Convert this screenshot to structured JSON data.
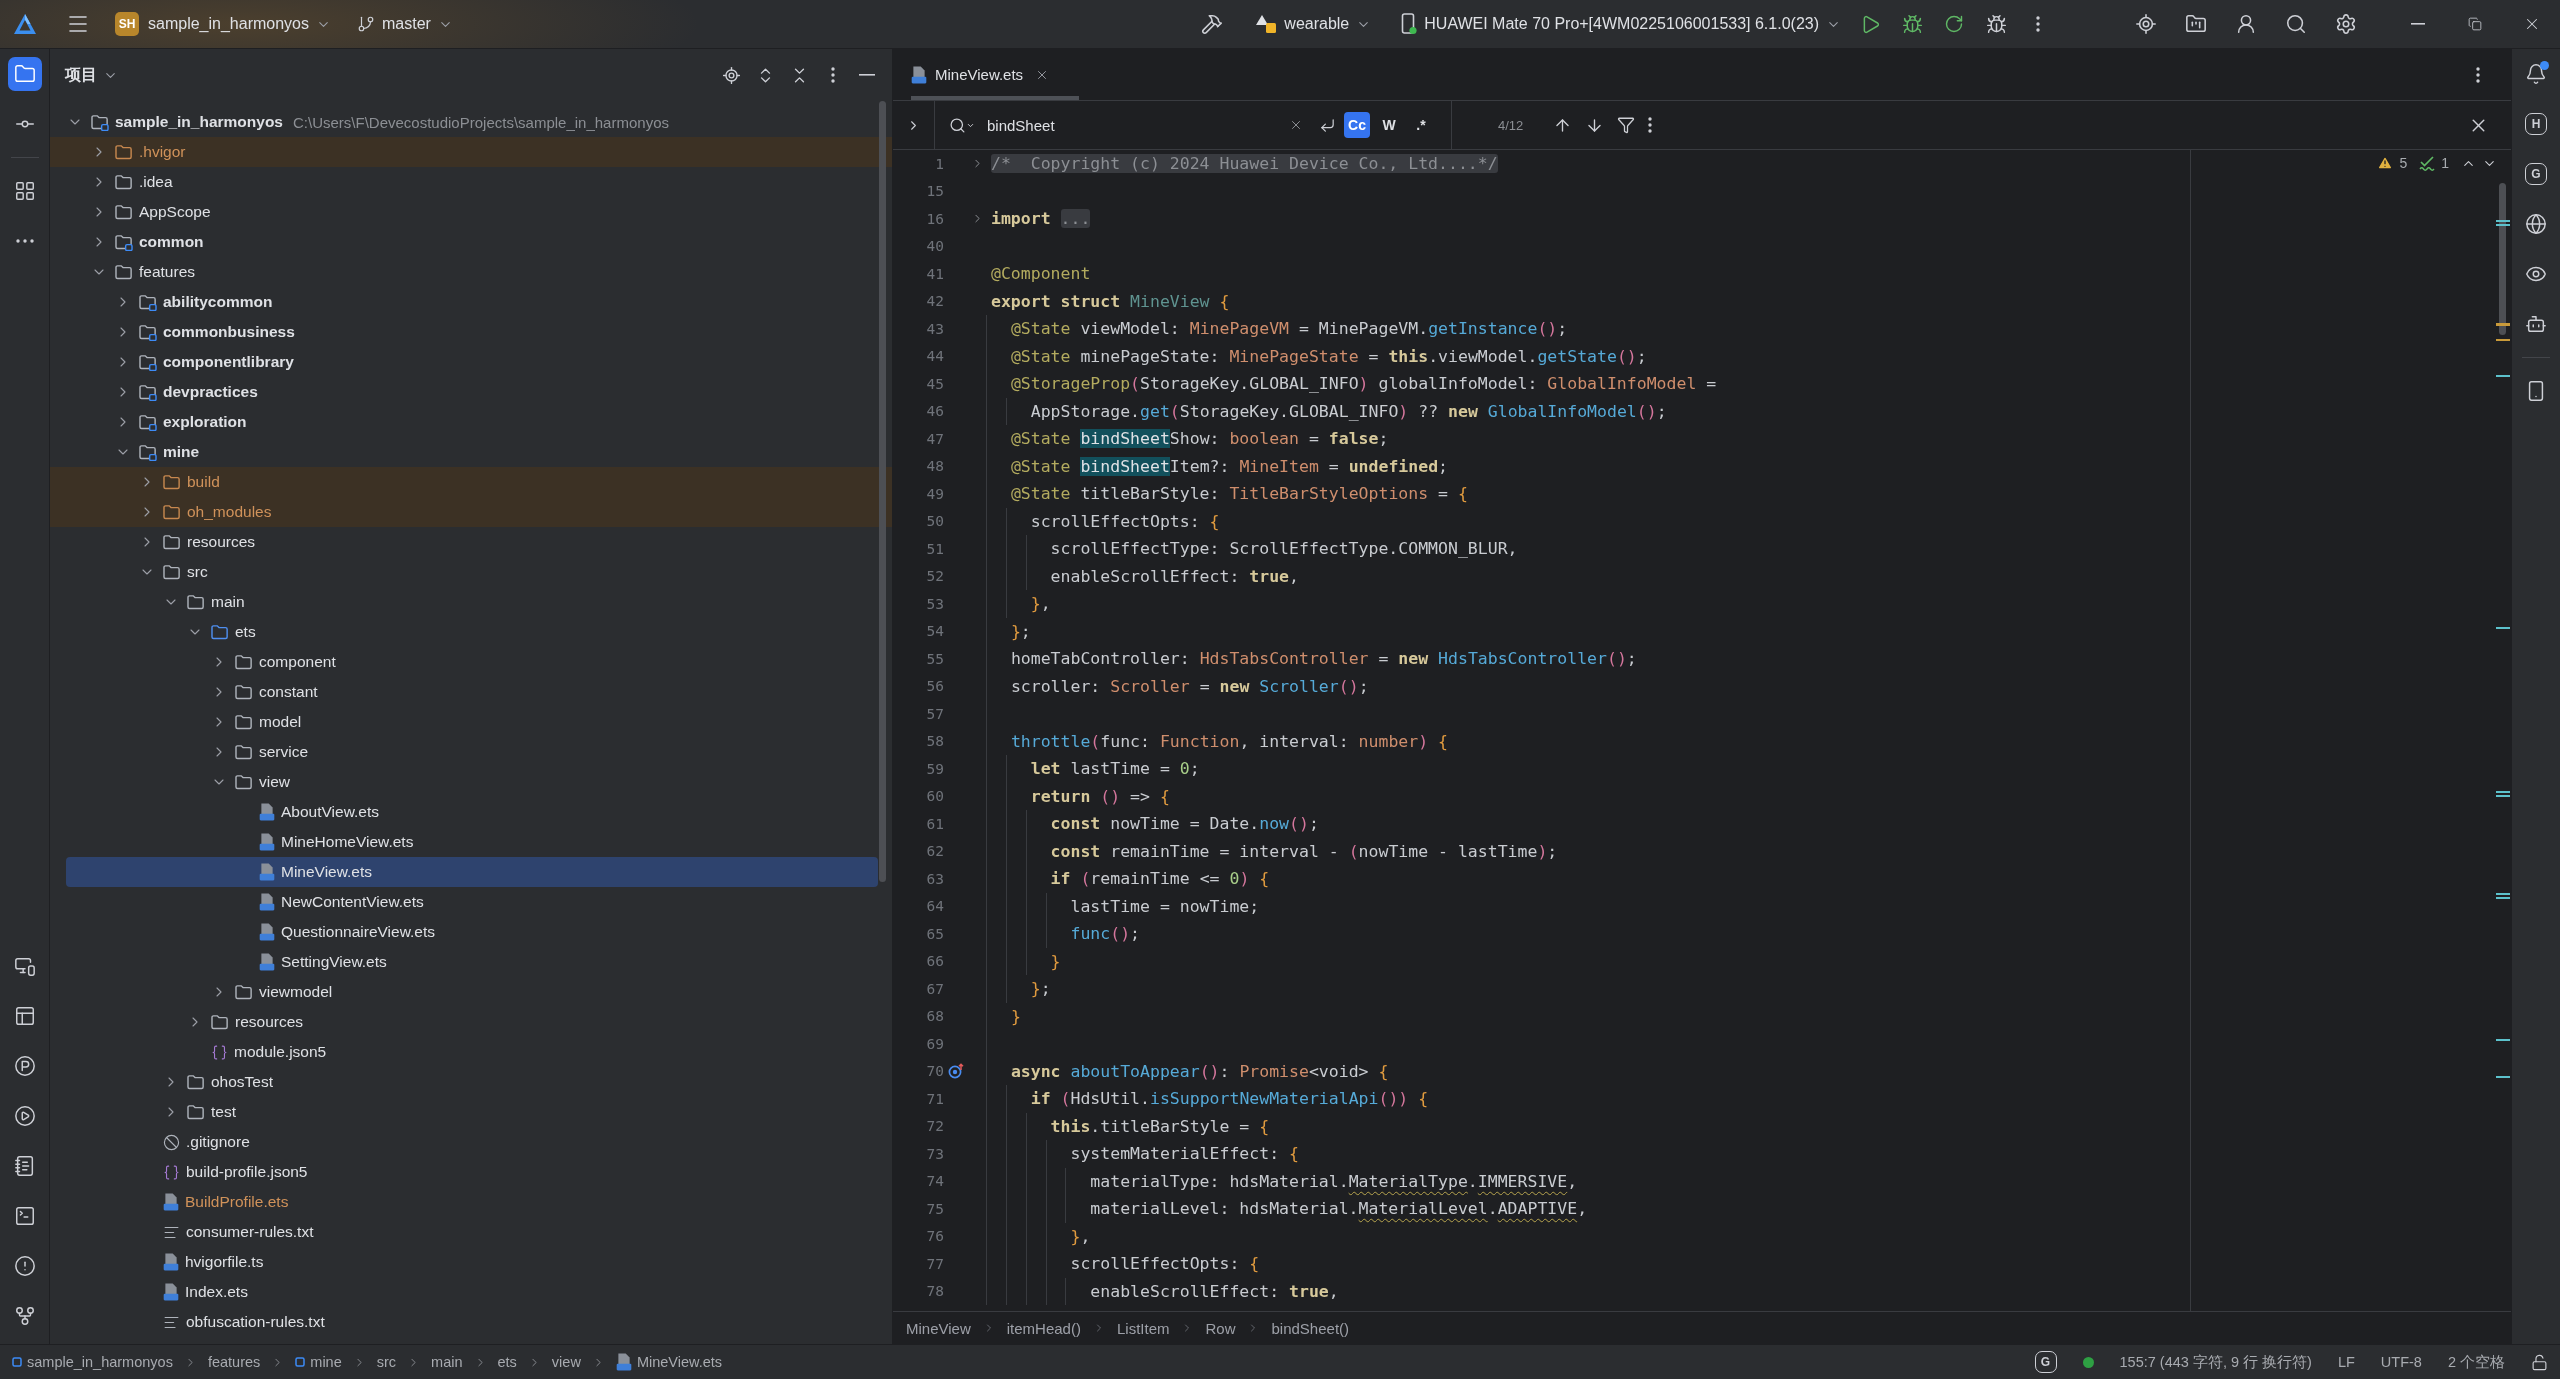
{
  "title_bar": {
    "project_badge": "SH",
    "project_name": "sample_in_harmonyos",
    "branch": "master",
    "run_configuration": "wearable",
    "device": "HUAWEI Mate 70 Pro+[4WM0225106001533] 6.1.0(23)"
  },
  "tool_windows": {
    "top": [
      [
        {
          "kind": "project",
          "selected": true
        },
        {
          "kind": "commit",
          "selected": false
        }
      ],
      [
        {
          "kind": "structure",
          "selected": false
        },
        {
          "kind": "more",
          "selected": false
        }
      ]
    ],
    "bottom": [
      {
        "kind": "device-manager",
        "selected": false
      },
      {
        "kind": "layout",
        "selected": false
      },
      {
        "kind": "profiler",
        "selected": false
      },
      {
        "kind": "run",
        "selected": false
      },
      {
        "kind": "log",
        "selected": false
      },
      {
        "kind": "terminal",
        "selected": false
      },
      {
        "kind": "problems",
        "selected": false
      },
      {
        "kind": "git",
        "selected": false
      }
    ]
  },
  "project_panel": {
    "title": "项目",
    "tree": {
      "label": "sample_in_harmonyos",
      "path": "C:\\Users\\F\\DevecostudioProjects\\sample_in_harmonyos",
      "kind": "module",
      "expanded": true,
      "selected": false,
      "children": [
        {
          "label": ".hvigor",
          "kind": "excluded",
          "expanded": false,
          "selected": false
        },
        {
          "label": ".idea",
          "kind": "folder",
          "expanded": false,
          "selected": false
        },
        {
          "label": "AppScope",
          "kind": "folder",
          "expanded": false,
          "selected": false
        },
        {
          "label": "common",
          "kind": "module",
          "expanded": false,
          "selected": false
        },
        {
          "label": "features",
          "kind": "folder",
          "expanded": true,
          "selected": false,
          "children": [
            {
              "label": "abilitycommon",
              "kind": "module",
              "expanded": false,
              "selected": false
            },
            {
              "label": "commonbusiness",
              "kind": "module",
              "expanded": false,
              "selected": false
            },
            {
              "label": "componentlibrary",
              "kind": "module",
              "expanded": false,
              "selected": false
            },
            {
              "label": "devpractices",
              "kind": "module",
              "expanded": false,
              "selected": false
            },
            {
              "label": "exploration",
              "kind": "module",
              "expanded": false,
              "selected": false
            },
            {
              "label": "mine",
              "kind": "module",
              "expanded": true,
              "selected": false,
              "children": [
                {
                  "label": "build",
                  "kind": "excluded",
                  "expanded": false,
                  "selected": false
                },
                {
                  "label": "oh_modules",
                  "kind": "excluded",
                  "expanded": false,
                  "selected": false
                },
                {
                  "label": "resources",
                  "kind": "folder",
                  "expanded": false,
                  "selected": false
                },
                {
                  "label": "src",
                  "kind": "folder",
                  "expanded": true,
                  "selected": false,
                  "children": [
                    {
                      "label": "main",
                      "kind": "folder",
                      "expanded": true,
                      "selected": false,
                      "children": [
                        {
                          "label": "ets",
                          "kind": "source",
                          "expanded": true,
                          "selected": false,
                          "children": [
                            {
                              "label": "component",
                              "kind": "folder",
                              "expanded": false,
                              "selected": false
                            },
                            {
                              "label": "constant",
                              "kind": "folder",
                              "expanded": false,
                              "selected": false
                            },
                            {
                              "label": "model",
                              "kind": "folder",
                              "expanded": false,
                              "selected": false
                            },
                            {
                              "label": "service",
                              "kind": "folder",
                              "expanded": false,
                              "selected": false
                            },
                            {
                              "label": "view",
                              "kind": "folder",
                              "expanded": true,
                              "selected": false,
                              "children": [
                                {
                                  "label": "AboutView.ets",
                                  "kind": "ets",
                                  "selected": false
                                },
                                {
                                  "label": "MineHomeView.ets",
                                  "kind": "ets",
                                  "selected": false
                                },
                                {
                                  "label": "MineView.ets",
                                  "kind": "ets",
                                  "selected": true
                                },
                                {
                                  "label": "NewContentView.ets",
                                  "kind": "ets",
                                  "selected": false
                                },
                                {
                                  "label": "QuestionnaireView.ets",
                                  "kind": "ets",
                                  "selected": false
                                },
                                {
                                  "label": "SettingView.ets",
                                  "kind": "ets",
                                  "selected": false
                                }
                              ]
                            },
                            {
                              "label": "viewmodel",
                              "kind": "folder",
                              "expanded": false,
                              "selected": false
                            }
                          ]
                        },
                        {
                          "label": "resources",
                          "kind": "folder",
                          "expanded": false,
                          "selected": false
                        },
                        {
                          "label": "module.json5",
                          "kind": "json5",
                          "selected": false
                        }
                      ]
                    },
                    {
                      "label": "ohosTest",
                      "kind": "folder",
                      "expanded": false,
                      "selected": false
                    },
                    {
                      "label": "test",
                      "kind": "folder",
                      "expanded": false,
                      "selected": false
                    }
                  ]
                },
                {
                  "label": ".gitignore",
                  "kind": "ignore",
                  "selected": false
                },
                {
                  "label": "build-profile.json5",
                  "kind": "json5",
                  "selected": false
                },
                {
                  "label": "BuildProfile.ets",
                  "kind": "generated",
                  "selected": false
                },
                {
                  "label": "consumer-rules.txt",
                  "kind": "text",
                  "selected": false
                },
                {
                  "label": "hvigorfile.ts",
                  "kind": "ts",
                  "selected": false
                },
                {
                  "label": "Index.ets",
                  "kind": "ets",
                  "selected": false
                },
                {
                  "label": "obfuscation-rules.txt",
                  "kind": "text",
                  "selected": false
                }
              ]
            }
          ]
        }
      ]
    }
  },
  "editor": {
    "tabs": [
      {
        "label": "MineView.ets",
        "selected": true
      }
    ],
    "find": {
      "query": "bindSheet",
      "options": [
        {
          "label": "Cc",
          "selected": true
        },
        {
          "label": "W",
          "selected": false
        },
        {
          "label": ".*",
          "selected": false
        }
      ],
      "match_count": "4/12"
    },
    "inspections": {
      "warnings": "5",
      "typos": "1"
    },
    "code": [
      {
        "number": "1",
        "folded": true,
        "tokens": [
          {
            "text": "/*  Copyright (c) 2024 Huawei Device Co., Ltd....*/",
            "kind": "fold"
          }
        ]
      },
      {
        "number": "15"
      },
      {
        "number": "16",
        "folded": true,
        "tokens": [
          {
            "text": "import ",
            "kind": "kw"
          },
          {
            "text": "...",
            "kind": "fold"
          }
        ]
      },
      {
        "number": "40"
      },
      {
        "number": "41",
        "tokens": [
          {
            "text": "@Component",
            "kind": "deco"
          }
        ]
      },
      {
        "number": "42",
        "tokens": [
          {
            "text": "export struct ",
            "kind": "kw"
          },
          {
            "text": "MineView ",
            "kind": "name"
          },
          {
            "text": "{",
            "kind": "brace"
          }
        ]
      },
      {
        "number": "43",
        "tokens": [
          {
            "text": "  @State",
            "kind": "deco"
          },
          {
            "text": " viewModel: ",
            "kind": "plain"
          },
          {
            "text": "MinePageVM",
            "kind": "type"
          },
          {
            "text": " = MinePageVM.",
            "kind": "plain"
          },
          {
            "text": "getInstance",
            "kind": "fn"
          },
          {
            "text": "()",
            "kind": "paren"
          },
          {
            "text": ";",
            "kind": "plain"
          }
        ]
      },
      {
        "number": "44",
        "tokens": [
          {
            "text": "  @State",
            "kind": "deco"
          },
          {
            "text": " minePageState: ",
            "kind": "plain"
          },
          {
            "text": "MinePageState",
            "kind": "type"
          },
          {
            "text": " = ",
            "kind": "plain"
          },
          {
            "text": "this",
            "kind": "kw"
          },
          {
            "text": ".viewModel.",
            "kind": "plain"
          },
          {
            "text": "getState",
            "kind": "fn"
          },
          {
            "text": "()",
            "kind": "paren"
          },
          {
            "text": ";",
            "kind": "plain"
          }
        ]
      },
      {
        "number": "45",
        "tokens": [
          {
            "text": "  @StorageProp",
            "kind": "deco"
          },
          {
            "text": "(",
            "kind": "paren"
          },
          {
            "text": "StorageKey.GLOBAL_INFO",
            "kind": "plain"
          },
          {
            "text": ")",
            "kind": "paren"
          },
          {
            "text": " globalInfoModel: ",
            "kind": "plain"
          },
          {
            "text": "GlobalInfoModel",
            "kind": "type"
          },
          {
            "text": " =",
            "kind": "plain"
          }
        ]
      },
      {
        "number": "46",
        "tokens": [
          {
            "text": "    AppStorage.",
            "kind": "plain"
          },
          {
            "text": "get",
            "kind": "fn"
          },
          {
            "text": "(",
            "kind": "paren"
          },
          {
            "text": "StorageKey.GLOBAL_INFO",
            "kind": "plain"
          },
          {
            "text": ")",
            "kind": "paren"
          },
          {
            "text": " ?? ",
            "kind": "plain"
          },
          {
            "text": "new ",
            "kind": "kw"
          },
          {
            "text": "GlobalInfoModel",
            "kind": "fn"
          },
          {
            "text": "()",
            "kind": "paren"
          },
          {
            "text": ";",
            "kind": "plain"
          }
        ]
      },
      {
        "number": "47",
        "tokens": [
          {
            "text": "  @State ",
            "kind": "deco"
          },
          {
            "text": "bindSheet",
            "kind": "match"
          },
          {
            "text": "Show: ",
            "kind": "plain"
          },
          {
            "text": "boolean",
            "kind": "type"
          },
          {
            "text": " = ",
            "kind": "plain"
          },
          {
            "text": "false",
            "kind": "kw"
          },
          {
            "text": ";",
            "kind": "plain"
          }
        ]
      },
      {
        "number": "48",
        "tokens": [
          {
            "text": "  @State ",
            "kind": "deco"
          },
          {
            "text": "bindSheet",
            "kind": "match"
          },
          {
            "text": "Item?: ",
            "kind": "plain"
          },
          {
            "text": "MineItem",
            "kind": "type"
          },
          {
            "text": " = ",
            "kind": "plain"
          },
          {
            "text": "undefined",
            "kind": "kw"
          },
          {
            "text": ";",
            "kind": "plain"
          }
        ]
      },
      {
        "number": "49",
        "tokens": [
          {
            "text": "  @State",
            "kind": "deco"
          },
          {
            "text": " titleBarStyle: ",
            "kind": "plain"
          },
          {
            "text": "TitleBarStyleOptions",
            "kind": "type"
          },
          {
            "text": " = ",
            "kind": "plain"
          },
          {
            "text": "{",
            "kind": "brace"
          }
        ]
      },
      {
        "number": "50",
        "tokens": [
          {
            "text": "    scrollEffectOpts: ",
            "kind": "plain"
          },
          {
            "text": "{",
            "kind": "brace"
          }
        ]
      },
      {
        "number": "51",
        "tokens": [
          {
            "text": "      scrollEffectType: ScrollEffectType.COMMON_BLUR,",
            "kind": "plain"
          }
        ]
      },
      {
        "number": "52",
        "tokens": [
          {
            "text": "      enableScrollEffect: ",
            "kind": "plain"
          },
          {
            "text": "true",
            "kind": "kw"
          },
          {
            "text": ",",
            "kind": "plain"
          }
        ]
      },
      {
        "number": "53",
        "tokens": [
          {
            "text": "    }",
            "kind": "brace"
          },
          {
            "text": ",",
            "kind": "plain"
          }
        ]
      },
      {
        "number": "54",
        "tokens": [
          {
            "text": "  }",
            "kind": "brace"
          },
          {
            "text": ";",
            "kind": "plain"
          }
        ]
      },
      {
        "number": "55",
        "tokens": [
          {
            "text": "  homeTabController: ",
            "kind": "plain"
          },
          {
            "text": "HdsTabsController",
            "kind": "type"
          },
          {
            "text": " = ",
            "kind": "plain"
          },
          {
            "text": "new ",
            "kind": "kw"
          },
          {
            "text": "HdsTabsController",
            "kind": "fn"
          },
          {
            "text": "()",
            "kind": "paren"
          },
          {
            "text": ";",
            "kind": "plain"
          }
        ]
      },
      {
        "number": "56",
        "tokens": [
          {
            "text": "  scroller: ",
            "kind": "plain"
          },
          {
            "text": "Scroller",
            "kind": "type"
          },
          {
            "text": " = ",
            "kind": "plain"
          },
          {
            "text": "new ",
            "kind": "kw"
          },
          {
            "text": "Scroller",
            "kind": "fn"
          },
          {
            "text": "()",
            "kind": "paren"
          },
          {
            "text": ";",
            "kind": "plain"
          }
        ]
      },
      {
        "number": "57"
      },
      {
        "number": "58",
        "tokens": [
          {
            "text": "  throttle",
            "kind": "fn"
          },
          {
            "text": "(",
            "kind": "paren"
          },
          {
            "text": "func: ",
            "kind": "plain"
          },
          {
            "text": "Function",
            "kind": "type"
          },
          {
            "text": ", interval: ",
            "kind": "plain"
          },
          {
            "text": "number",
            "kind": "type"
          },
          {
            "text": ") ",
            "kind": "paren"
          },
          {
            "text": "{",
            "kind": "brace"
          }
        ]
      },
      {
        "number": "59",
        "tokens": [
          {
            "text": "    let",
            "kind": "kw"
          },
          {
            "text": " lastTime = ",
            "kind": "plain"
          },
          {
            "text": "0",
            "kind": "num"
          },
          {
            "text": ";",
            "kind": "plain"
          }
        ]
      },
      {
        "number": "60",
        "tokens": [
          {
            "text": "    return ",
            "kind": "kw"
          },
          {
            "text": "()",
            "kind": "paren"
          },
          {
            "text": " => ",
            "kind": "plain"
          },
          {
            "text": "{",
            "kind": "brace"
          }
        ]
      },
      {
        "number": "61",
        "tokens": [
          {
            "text": "      const",
            "kind": "kw"
          },
          {
            "text": " nowTime = Date.",
            "kind": "plain"
          },
          {
            "text": "now",
            "kind": "fn"
          },
          {
            "text": "()",
            "kind": "paren"
          },
          {
            "text": ";",
            "kind": "plain"
          }
        ]
      },
      {
        "number": "62",
        "tokens": [
          {
            "text": "      const",
            "kind": "kw"
          },
          {
            "text": " remainTime = interval - ",
            "kind": "plain"
          },
          {
            "text": "(",
            "kind": "paren"
          },
          {
            "text": "nowTime - lastTime",
            "kind": "plain"
          },
          {
            "text": ")",
            "kind": "paren"
          },
          {
            "text": ";",
            "kind": "plain"
          }
        ]
      },
      {
        "number": "63",
        "tokens": [
          {
            "text": "      if ",
            "kind": "kw"
          },
          {
            "text": "(",
            "kind": "paren"
          },
          {
            "text": "remainTime <= ",
            "kind": "plain"
          },
          {
            "text": "0",
            "kind": "num"
          },
          {
            "text": ") ",
            "kind": "paren"
          },
          {
            "text": "{",
            "kind": "brace"
          }
        ]
      },
      {
        "number": "64",
        "tokens": [
          {
            "text": "        lastTime = nowTime;",
            "kind": "plain"
          }
        ]
      },
      {
        "number": "65",
        "tokens": [
          {
            "text": "        func",
            "kind": "fn"
          },
          {
            "text": "()",
            "kind": "paren"
          },
          {
            "text": ";",
            "kind": "plain"
          }
        ]
      },
      {
        "number": "66",
        "tokens": [
          {
            "text": "      }",
            "kind": "brace"
          }
        ]
      },
      {
        "number": "67",
        "tokens": [
          {
            "text": "    }",
            "kind": "brace"
          },
          {
            "text": ";",
            "kind": "plain"
          }
        ]
      },
      {
        "number": "68",
        "tokens": [
          {
            "text": "  }",
            "kind": "brace"
          }
        ]
      },
      {
        "number": "69"
      },
      {
        "number": "70",
        "overrides": true,
        "tokens": [
          {
            "text": "  async ",
            "kind": "kw"
          },
          {
            "text": "aboutToAppear",
            "kind": "fn"
          },
          {
            "text": "()",
            "kind": "paren"
          },
          {
            "text": ": ",
            "kind": "plain"
          },
          {
            "text": "Promise",
            "kind": "type"
          },
          {
            "text": "<void> ",
            "kind": "plain"
          },
          {
            "text": "{",
            "kind": "brace"
          }
        ]
      },
      {
        "number": "71",
        "tokens": [
          {
            "text": "    if ",
            "kind": "kw"
          },
          {
            "text": "(",
            "kind": "paren"
          },
          {
            "text": "HdsUtil.",
            "kind": "plain"
          },
          {
            "text": "isSupportNewMaterialApi",
            "kind": "fn"
          },
          {
            "text": "()) ",
            "kind": "paren"
          },
          {
            "text": "{",
            "kind": "brace"
          }
        ]
      },
      {
        "number": "72",
        "tokens": [
          {
            "text": "      this",
            "kind": "kw"
          },
          {
            "text": ".titleBarStyle = ",
            "kind": "plain"
          },
          {
            "text": "{",
            "kind": "brace"
          }
        ]
      },
      {
        "number": "73",
        "tokens": [
          {
            "text": "        systemMaterialEffect: ",
            "kind": "plain"
          },
          {
            "text": "{",
            "kind": "brace"
          }
        ]
      },
      {
        "number": "74",
        "tokens": [
          {
            "text": "          materialType: hdsMaterial.",
            "kind": "plain"
          },
          {
            "text": "MaterialType",
            "kind": "warn"
          },
          {
            "text": ".",
            "kind": "plain"
          },
          {
            "text": "IMMERSIVE",
            "kind": "warn"
          },
          {
            "text": ",",
            "kind": "plain"
          }
        ]
      },
      {
        "number": "75",
        "tokens": [
          {
            "text": "          materialLevel: hdsMaterial.",
            "kind": "plain"
          },
          {
            "text": "MaterialLevel",
            "kind": "warn"
          },
          {
            "text": ".",
            "kind": "plain"
          },
          {
            "text": "ADAPTIVE",
            "kind": "warn"
          },
          {
            "text": ",",
            "kind": "plain"
          }
        ]
      },
      {
        "number": "76",
        "tokens": [
          {
            "text": "        }",
            "kind": "brace"
          },
          {
            "text": ",",
            "kind": "plain"
          }
        ]
      },
      {
        "number": "77",
        "tokens": [
          {
            "text": "        scrollEffectOpts: ",
            "kind": "plain"
          },
          {
            "text": "{",
            "kind": "brace"
          }
        ]
      },
      {
        "number": "78",
        "tokens": [
          {
            "text": "          enableScrollEffect: ",
            "kind": "plain"
          },
          {
            "text": "true",
            "kind": "kw"
          },
          {
            "text": ",",
            "kind": "plain"
          }
        ]
      }
    ],
    "breadcrumbs": [
      "MineView",
      "itemHead()",
      "ListItem",
      "Row",
      "bindSheet()"
    ]
  },
  "right_tools": {
    "groups": [
      [
        {
          "kind": "notifications",
          "unread": true
        },
        {
          "kind": "glyph",
          "glyph": "H"
        },
        {
          "kind": "glyph",
          "glyph": "G"
        },
        {
          "kind": "previewer"
        },
        {
          "kind": "eye"
        },
        {
          "kind": "robot"
        }
      ],
      [
        {
          "kind": "device"
        }
      ]
    ]
  },
  "status_bar": {
    "path": [
      {
        "label": "sample_in_harmonyos",
        "kind": "module"
      },
      {
        "label": "features",
        "kind": "folder"
      },
      {
        "label": "mine",
        "kind": "module"
      },
      {
        "label": "src",
        "kind": "folder"
      },
      {
        "label": "main",
        "kind": "folder"
      },
      {
        "label": "ets",
        "kind": "folder"
      },
      {
        "label": "view",
        "kind": "folder"
      },
      {
        "label": "MineView.ets",
        "kind": "ets"
      }
    ],
    "plugin_glyph": "G",
    "position": "155:7 (443 字符, 9 行 换行符)",
    "line_separator": "LF",
    "encoding": "UTF-8",
    "indent": "2 个空格"
  }
}
